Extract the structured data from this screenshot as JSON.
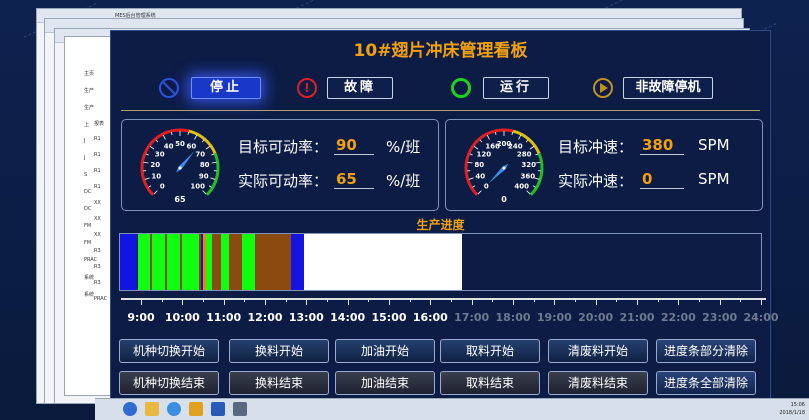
{
  "browser": {
    "tab_title": "MES后台管理系统"
  },
  "left_panel": {
    "items": [
      "主页",
      "生产",
      "生产",
      "上",
      "J",
      "J",
      "S",
      "DC",
      "DC",
      "FM",
      "FM",
      "PRAC",
      "系统",
      "系统"
    ],
    "sub_items": [
      "报表",
      "R1",
      "R1",
      "R1",
      "R1",
      "XX",
      "XX",
      "XX",
      "R3",
      "R3",
      "R3",
      "PRAC"
    ]
  },
  "dashboard": {
    "title": "10#翅片冲床管理看板",
    "statuses": [
      {
        "label": "停止",
        "color": "#1838c8",
        "icon": "stop-icon",
        "active": true
      },
      {
        "label": "故障",
        "color": "#e02020",
        "icon": "fault-icon",
        "active": false
      },
      {
        "label": "运行",
        "color": "#20d020",
        "icon": "run-icon",
        "active": false
      },
      {
        "label": "非故障停机",
        "color": "#c09020",
        "icon": "pause-icon",
        "active": false
      }
    ],
    "availability": {
      "target_label": "目标可动率：",
      "target_value": "90",
      "actual_label": "实际可动率：",
      "actual_value": "65",
      "unit": "%/班",
      "gauge": {
        "min": 0,
        "max": 100,
        "value": 65,
        "ticks": [
          "0",
          "10",
          "20",
          "30",
          "40",
          "50",
          "60",
          "70",
          "80",
          "90",
          "100"
        ],
        "readout": "65"
      }
    },
    "speed": {
      "target_label": "目标冲速：",
      "target_value": "380",
      "actual_label": "实际冲速：",
      "actual_value": "0",
      "unit": "SPM",
      "gauge": {
        "min": 0,
        "max": 400,
        "value": 0,
        "ticks": [
          "0",
          "40",
          "80",
          "120",
          "160",
          "200",
          "240",
          "280",
          "320",
          "360",
          "400"
        ],
        "readout": "0"
      }
    },
    "progress_title": "生产进度",
    "timeline": {
      "labels": [
        "9:00",
        "10:00",
        "11:00",
        "12:00",
        "13:00",
        "14:00",
        "15:00",
        "16:00",
        "17:00",
        "18:00",
        "19:00",
        "20:00",
        "21:00",
        "22:00",
        "23:00",
        "24:00"
      ],
      "past_color": "#ffffff",
      "future_color": "#6e7a90",
      "current_index": 7
    },
    "progress_segments": [
      {
        "color": "#1414e0",
        "start": 0.0,
        "end": 0.027
      },
      {
        "color": "#101c40",
        "start": 0.027,
        "end": 0.028
      },
      {
        "color": "#10ff10",
        "start": 0.028,
        "end": 0.047
      },
      {
        "color": "#8b4a10",
        "start": 0.047,
        "end": 0.05
      },
      {
        "color": "#10ff10",
        "start": 0.05,
        "end": 0.07
      },
      {
        "color": "#8b4a10",
        "start": 0.07,
        "end": 0.073
      },
      {
        "color": "#10ff10",
        "start": 0.073,
        "end": 0.093
      },
      {
        "color": "#8b4a10",
        "start": 0.093,
        "end": 0.097
      },
      {
        "color": "#10ff10",
        "start": 0.097,
        "end": 0.123
      },
      {
        "color": "#8b4a10",
        "start": 0.123,
        "end": 0.127
      },
      {
        "color": "#1414e0",
        "start": 0.127,
        "end": 0.13
      },
      {
        "color": "#ff8000",
        "start": 0.13,
        "end": 0.134
      },
      {
        "color": "#10ff10",
        "start": 0.134,
        "end": 0.143
      },
      {
        "color": "#8b4a10",
        "start": 0.143,
        "end": 0.157
      },
      {
        "color": "#10ff10",
        "start": 0.157,
        "end": 0.17
      },
      {
        "color": "#8b4a10",
        "start": 0.17,
        "end": 0.19
      },
      {
        "color": "#10ff10",
        "start": 0.19,
        "end": 0.21
      },
      {
        "color": "#8b4a10",
        "start": 0.21,
        "end": 0.267
      },
      {
        "color": "#1414e0",
        "start": 0.267,
        "end": 0.287
      },
      {
        "color": "#ffffff",
        "start": 0.287,
        "end": 0.533
      }
    ],
    "controls_row1": [
      "机种切换开始",
      "换料开始",
      "加油开始",
      "取料开始",
      "清废料开始",
      "进度条部分清除"
    ],
    "controls_row2": [
      "机种切换结束",
      "换料结束",
      "加油结束",
      "取料结束",
      "清废料结束",
      "进度条全部清除"
    ]
  },
  "taskbar": {
    "time": "15:06",
    "date": "2018/1/18"
  }
}
